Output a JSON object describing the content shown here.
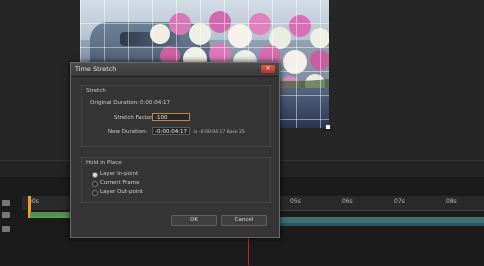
{
  "dialog": {
    "title": "Time Stretch",
    "close_glyph": "×",
    "stretch_group_label": "Stretch",
    "original_duration_label": "Original Duration:",
    "original_duration_value": "0:00:04:17",
    "stretch_factor_label": "Stretch Factor:",
    "stretch_factor_value": "-100",
    "new_duration_label": "New Duration:",
    "new_duration_value": "-0:00:04:17",
    "new_duration_note": "is -0:00:04:17  Base 25",
    "hold_group_label": "Hold in Place",
    "hold_options": [
      "Layer In-point",
      "Current Frame",
      "Layer Out-point"
    ],
    "hold_selected_index": 0,
    "ok_label": "OK",
    "cancel_label": "Cancel"
  },
  "timeline": {
    "ruler_left_label": "00s",
    "ruler_ticks": [
      "05s",
      "06s",
      "07s",
      "08s"
    ]
  },
  "colors": {
    "playhead": "#d0202a",
    "work_area": "#3f6f74",
    "cti": "#f0a020"
  },
  "icons": {
    "close": "close-icon"
  }
}
